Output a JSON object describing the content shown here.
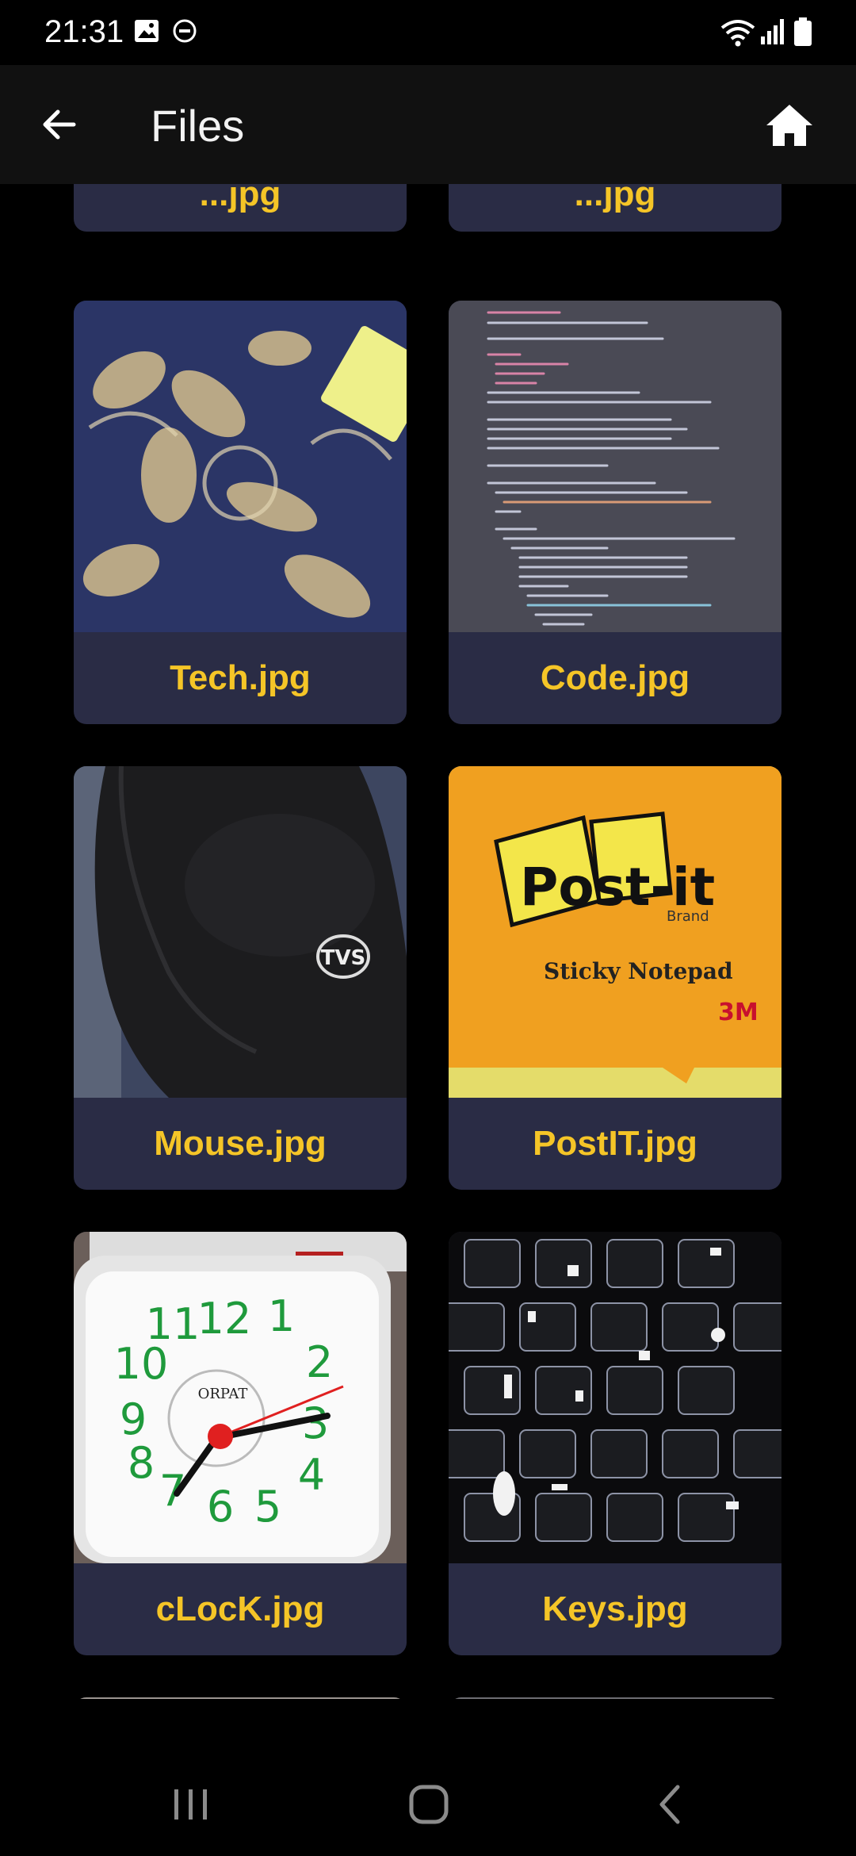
{
  "status_bar": {
    "time": "21:31",
    "icons": [
      "image-icon",
      "dnd-icon",
      "wifi-icon",
      "signal-icon",
      "battery-icon"
    ]
  },
  "app_bar": {
    "title": "Files",
    "back_icon": "arrow-left-icon",
    "home_icon": "home-icon"
  },
  "colors": {
    "background": "#000000",
    "app_bar": "#111111",
    "card": "#2a2c45",
    "caption_text": "#f5c527"
  },
  "files": [
    {
      "name": "Tech.jpg"
    },
    {
      "name": "Code.jpg"
    },
    {
      "name": "Mouse.jpg"
    },
    {
      "name": "PostIT.jpg"
    },
    {
      "name": "cLocK.jpg"
    },
    {
      "name": "Keys.jpg"
    }
  ],
  "partial_top_labels": [
    "...jpg",
    "...jpg"
  ],
  "postit_image": {
    "brand": "Post-it",
    "sub": "Brand",
    "product": "Sticky Notepad",
    "maker": "3M"
  },
  "mouse_image": {
    "brand": "TVS"
  },
  "clock_image": {
    "brand": "ORPAT",
    "numbers": [
      "11",
      "12",
      "1",
      "2",
      "3",
      "4",
      "5",
      "6",
      "7",
      "8",
      "9",
      "10"
    ]
  },
  "nav_bar": {
    "recents_icon": "recents-icon",
    "home_icon": "nav-home-icon",
    "back_icon": "nav-back-icon"
  }
}
